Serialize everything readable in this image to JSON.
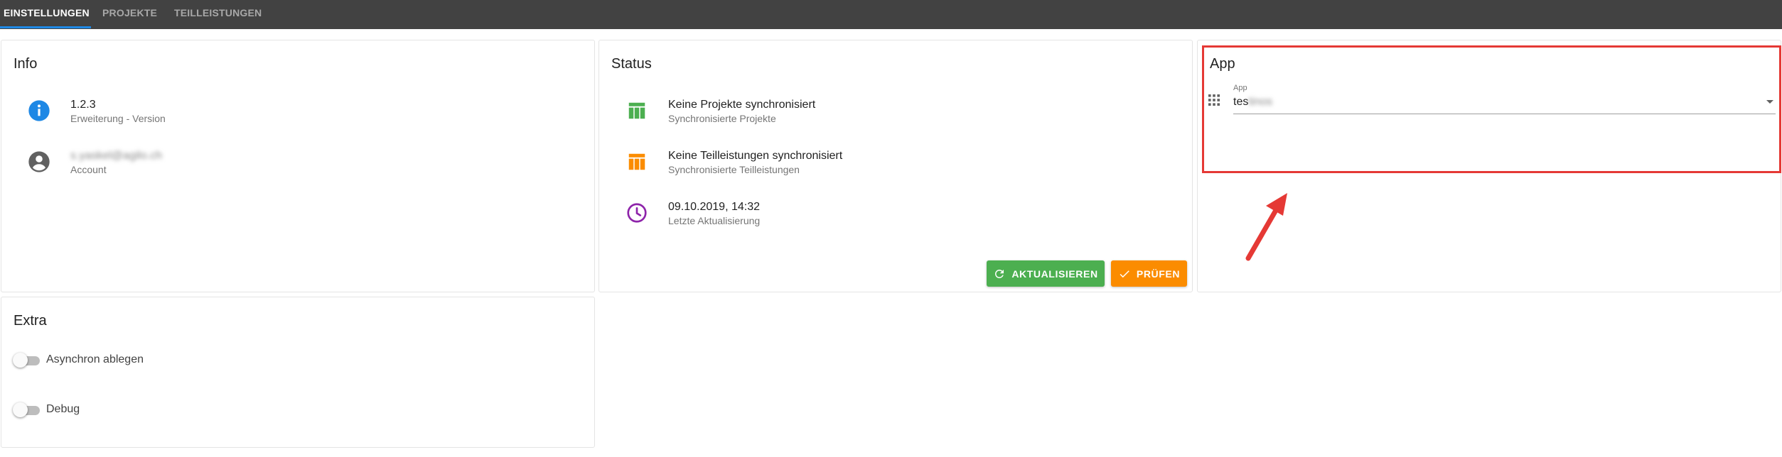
{
  "tabs": [
    {
      "label": "EINSTELLUNGEN",
      "active": true
    },
    {
      "label": "PROJEKTE",
      "active": false
    },
    {
      "label": "TEILLEISTUNGEN",
      "active": false
    }
  ],
  "info": {
    "title": "Info",
    "version": {
      "value": "1.2.3",
      "label": "Erweiterung - Version",
      "icon": "info-icon"
    },
    "account": {
      "value": "s.yaskel@agilo.ch",
      "label": "Account",
      "icon": "account-icon"
    }
  },
  "status": {
    "title": "Status",
    "items": [
      {
        "value": "Keine Projekte synchronisiert",
        "label": "Synchronisierte Projekte",
        "icon": "table-icon",
        "color": "#4caf50"
      },
      {
        "value": "Keine Teilleistungen synchronisiert",
        "label": "Synchronisierte Teilleistungen",
        "icon": "table-icon",
        "color": "#fb8c00"
      },
      {
        "value": "09.10.2019, 14:32",
        "label": "Letzte Aktualisierung",
        "icon": "clock-icon",
        "color": "#8e24aa"
      }
    ],
    "refresh_label": "AKTUALISIEREN",
    "check_label": "PRÜFEN"
  },
  "app": {
    "title": "App",
    "field_label": "App",
    "value_visible": "tes",
    "value_blurred": "tinos",
    "icon": "apps-grid-icon"
  },
  "extra": {
    "title": "Extra",
    "toggles": [
      {
        "label": "Asynchron ablegen",
        "on": false
      },
      {
        "label": "Debug",
        "on": false
      }
    ]
  },
  "colors": {
    "topbar": "#424242",
    "accent": "#1e88e5",
    "success": "#4caf50",
    "warning": "#fb8c00",
    "annotation": "#e53935"
  }
}
